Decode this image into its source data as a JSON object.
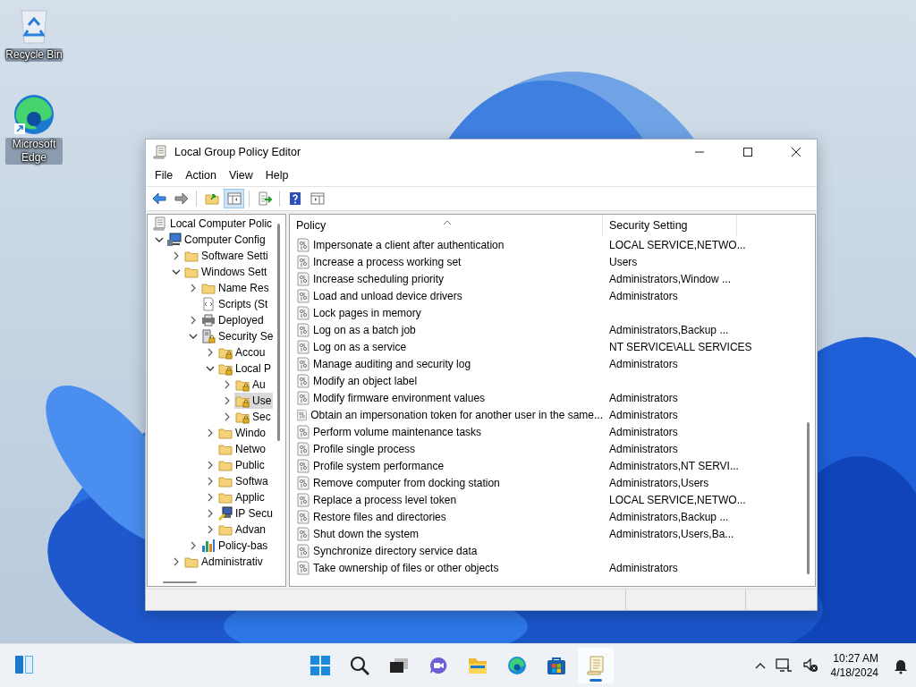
{
  "desktop_icons": [
    {
      "label": "Recycle Bin",
      "kind": "recycle"
    },
    {
      "label": "Microsoft Edge",
      "kind": "edge"
    }
  ],
  "window": {
    "title": "Local Group Policy Editor"
  },
  "menu": [
    "File",
    "Action",
    "View",
    "Help"
  ],
  "toolbar": [
    {
      "pressed": false
    },
    {
      "pressed": false
    },
    {
      "pressed": false
    },
    {
      "pressed": true
    },
    {
      "pressed": false
    },
    {
      "pressed": false
    },
    {
      "pressed": false
    }
  ],
  "tree": [
    {
      "label": "Local Computer Polic",
      "kind": "scroll",
      "selected": false,
      "children": [
        {
          "label": "Computer Config",
          "kind": "computer",
          "expanded": true,
          "selected": false,
          "children": [
            {
              "label": "Software Setti",
              "kind": "folder",
              "expanded": false,
              "selected": false
            },
            {
              "label": "Windows Sett",
              "kind": "folder",
              "expanded": true,
              "selected": false,
              "children": [
                {
                  "label": "Name Res",
                  "kind": "folder",
                  "expanded": false,
                  "selected": false
                },
                {
                  "label": "Scripts (St",
                  "kind": "script",
                  "selected": false
                },
                {
                  "label": "Deployed",
                  "kind": "printer",
                  "expanded": false,
                  "selected": false
                },
                {
                  "label": "Security Se",
                  "kind": "server",
                  "expanded": true,
                  "selected": false,
                  "children": [
                    {
                      "label": "Accou",
                      "kind": "lockfolder",
                      "expanded": false,
                      "selected": false
                    },
                    {
                      "label": "Local P",
                      "kind": "lockfolder",
                      "expanded": true,
                      "selected": false,
                      "children": [
                        {
                          "label": "Au",
                          "kind": "lockfolder",
                          "expanded": false,
                          "selected": false
                        },
                        {
                          "label": "Use",
                          "kind": "lockfolder",
                          "expanded": false,
                          "selected": true
                        },
                        {
                          "label": "Sec",
                          "kind": "lockfolder",
                          "expanded": false,
                          "selected": false
                        }
                      ]
                    },
                    {
                      "label": "Windo",
                      "kind": "folder",
                      "expanded": false,
                      "selected": false
                    },
                    {
                      "label": "Netwo",
                      "kind": "folder",
                      "selected": false
                    },
                    {
                      "label": "Public",
                      "kind": "folder",
                      "expanded": false,
                      "selected": false
                    },
                    {
                      "label": "Softwa",
                      "kind": "folder",
                      "expanded": false,
                      "selected": false
                    },
                    {
                      "label": "Applic",
                      "kind": "folder",
                      "expanded": false,
                      "selected": false
                    },
                    {
                      "label": "IP Secu",
                      "kind": "network",
                      "expanded": false,
                      "selected": false
                    },
                    {
                      "label": "Advan",
                      "kind": "folder",
                      "expanded": false,
                      "selected": false
                    }
                  ]
                },
                {
                  "label": "Policy-bas",
                  "kind": "chart",
                  "expanded": false,
                  "selected": false
                }
              ]
            },
            {
              "label": "Administrativ",
              "kind": "folder",
              "expanded": false,
              "selected": false
            }
          ]
        }
      ]
    }
  ],
  "table": {
    "columns": [
      "Policy",
      "Security Setting"
    ],
    "rows": [
      {
        "policy": "Impersonate a client after authentication",
        "setting": "LOCAL SERVICE,NETWO..."
      },
      {
        "policy": "Increase a process working set",
        "setting": "Users"
      },
      {
        "policy": "Increase scheduling priority",
        "setting": "Administrators,Window ..."
      },
      {
        "policy": "Load and unload device drivers",
        "setting": "Administrators"
      },
      {
        "policy": "Lock pages in memory"
      },
      {
        "policy": "Log on as a batch job",
        "setting": "Administrators,Backup ..."
      },
      {
        "policy": "Log on as a service",
        "setting": "NT SERVICE\\ALL SERVICES"
      },
      {
        "policy": "Manage auditing and security log",
        "setting": "Administrators"
      },
      {
        "policy": "Modify an object label"
      },
      {
        "policy": "Modify firmware environment values",
        "setting": "Administrators"
      },
      {
        "policy": "Obtain an impersonation token for another user in the same...",
        "setting": "Administrators"
      },
      {
        "policy": "Perform volume maintenance tasks",
        "setting": "Administrators"
      },
      {
        "policy": "Profile single process",
        "setting": "Administrators"
      },
      {
        "policy": "Profile system performance",
        "setting": "Administrators,NT SERVI..."
      },
      {
        "policy": "Remove computer from docking station",
        "setting": "Administrators,Users"
      },
      {
        "policy": "Replace a process level token",
        "setting": "LOCAL SERVICE,NETWO..."
      },
      {
        "policy": "Restore files and directories",
        "setting": "Administrators,Backup ..."
      },
      {
        "policy": "Shut down the system",
        "setting": "Administrators,Users,Ba..."
      },
      {
        "policy": "Synchronize directory service data"
      },
      {
        "policy": "Take ownership of files or other objects",
        "setting": "Administrators"
      }
    ]
  },
  "taskbar": {
    "apps": [
      {
        "selected": false
      },
      {
        "selected": false
      },
      {
        "selected": false
      },
      {
        "selected": false
      },
      {
        "selected": false
      },
      {
        "selected": false
      },
      {
        "selected": false
      },
      {
        "selected": true
      }
    ],
    "time": "10:27 AM",
    "date": "4/18/2024"
  }
}
